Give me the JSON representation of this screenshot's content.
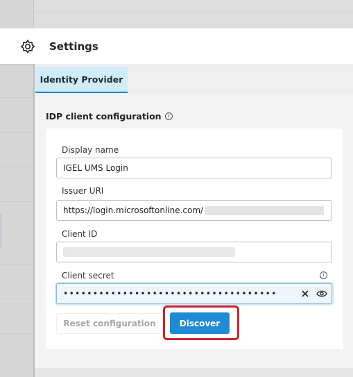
{
  "header": {
    "title": "Settings",
    "icon": "gear-icon"
  },
  "tabs": [
    {
      "label": "Identity Provider",
      "active": true
    }
  ],
  "section": {
    "title": "IDP client configuration"
  },
  "form": {
    "display_name": {
      "label": "Display name",
      "value": "IGEL UMS Login"
    },
    "issuer_uri": {
      "label": "Issuer URI",
      "value": "https://login.microsoftonline.com/"
    },
    "client_id": {
      "label": "Client ID"
    },
    "client_secret": {
      "label": "Client secret",
      "value": "••••••••••••••••••••••••••••••••••••"
    }
  },
  "buttons": {
    "reset": "Reset configuration",
    "discover": "Discover"
  },
  "colors": {
    "accent": "#1f8bd6",
    "tab_bg": "#d2ebf8",
    "highlight": "#c8232c"
  }
}
